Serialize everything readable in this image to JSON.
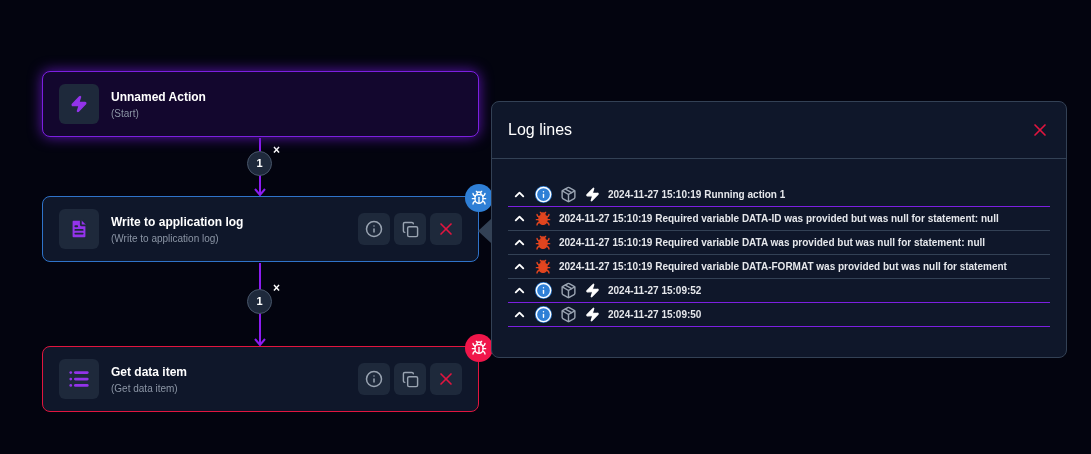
{
  "nodes": [
    {
      "kind": "start",
      "title": "Unnamed Action",
      "subtitle": "(Start)",
      "selected": false
    },
    {
      "kind": "log",
      "title": "Write to application log",
      "subtitle": "(Write to application log)",
      "selected": true,
      "badge": {
        "kind": "info"
      }
    },
    {
      "kind": "data",
      "title": "Get data item",
      "subtitle": "(Get data item)",
      "selected": false,
      "badge": {
        "kind": "error"
      }
    }
  ],
  "edges": [
    {
      "label": "1",
      "close": "×"
    },
    {
      "label": "1",
      "close": "×"
    }
  ],
  "log_panel": {
    "title": "Log lines",
    "lines": [
      {
        "kind": "info",
        "text": "2024-11-27 15:10:19 Running action 1"
      },
      {
        "kind": "error",
        "text": "2024-11-27 15:10:19 Required variable DATA-ID was provided but was null for statement: null"
      },
      {
        "kind": "error",
        "text": "2024-11-27 15:10:19 Required variable DATA was provided but was null for statement: null"
      },
      {
        "kind": "error",
        "text": "2024-11-27 15:10:19 Required variable DATA-FORMAT was provided but was null for statement"
      },
      {
        "kind": "info",
        "text": "2024-11-27 15:09:52"
      },
      {
        "kind": "info",
        "text": "2024-11-27 15:09:50"
      }
    ]
  }
}
